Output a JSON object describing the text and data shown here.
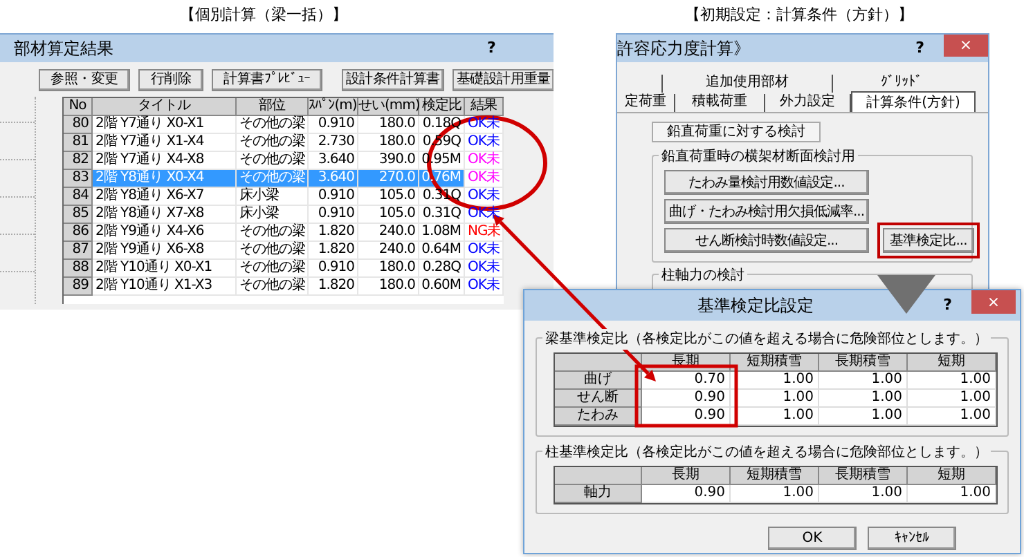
{
  "left_caption": "【個別計算（梁一括）】",
  "right_caption": "【初期設定：計算条件（方針）】",
  "result_window": {
    "title": "部材算定結果",
    "help": "?",
    "buttons": [
      "参照・変更",
      "行削除",
      "計算書ﾌﾟﾚﾋﾞｭｰ",
      "設計条件計算書",
      "基礎設計用重量"
    ],
    "table": {
      "columns": [
        "No",
        "タイトル",
        "部位",
        "ｽﾊﾟﾝ(m)",
        "せい(mm)",
        "検定比",
        "結果"
      ],
      "rows": [
        {
          "cells": [
            "80",
            "2階 Y7通り X0-X1",
            "その他の梁",
            "0.910",
            "180.0",
            "0.18Q",
            "OK未"
          ],
          "color": "#0000ff",
          "selected": false
        },
        {
          "cells": [
            "81",
            "2階 Y7通り X1-X4",
            "その他の梁",
            "2.730",
            "180.0",
            "0.59Q",
            "OK未"
          ],
          "color": "#0000ff",
          "selected": false
        },
        {
          "cells": [
            "82",
            "2階 Y7通り X4-X8",
            "その他の梁",
            "3.640",
            "390.0",
            "0.95M",
            "OK未"
          ],
          "color": "#ff00ff",
          "selected": false
        },
        {
          "cells": [
            "83",
            "2階 Y8通り X0-X4",
            "その他の梁",
            "3.640",
            "270.0",
            "0.76M",
            "OK未"
          ],
          "color": "#ff00ff",
          "selected": true
        },
        {
          "cells": [
            "84",
            "2階 Y8通り X6-X7",
            "床小梁",
            "0.910",
            "105.0",
            "0.31Q",
            "OK未"
          ],
          "color": "#0000ff",
          "selected": false
        },
        {
          "cells": [
            "85",
            "2階 Y8通り X7-X8",
            "床小梁",
            "0.910",
            "105.0",
            "0.31Q",
            "OK未"
          ],
          "color": "#0000ff",
          "selected": false
        },
        {
          "cells": [
            "86",
            "2階 Y9通り X4-X6",
            "その他の梁",
            "1.820",
            "240.0",
            "1.08M",
            "NG未"
          ],
          "color": "#ff0000",
          "selected": false
        },
        {
          "cells": [
            "87",
            "2階 Y9通り X6-X8",
            "その他の梁",
            "1.820",
            "240.0",
            "0.64M",
            "OK未"
          ],
          "color": "#0000ff",
          "selected": false
        },
        {
          "cells": [
            "88",
            "2階 Y10通り X0-X1",
            "その他の梁",
            "0.910",
            "180.0",
            "0.28Q",
            "OK未"
          ],
          "color": "#0000ff",
          "selected": false
        },
        {
          "cells": [
            "89",
            "2階 Y10通り X1-X3",
            "その他の梁",
            "1.820",
            "180.0",
            "0.60M",
            "OK未"
          ],
          "color": "#0000ff",
          "selected": false
        }
      ]
    }
  },
  "settings_window": {
    "title": "許容応力度計算》",
    "help": "?",
    "close": "×",
    "tabs_back": [
      {
        "label": "追加使用部材",
        "selected": false
      },
      {
        "label": "ｸﾞﾘｯﾄﾞ",
        "selected": false
      }
    ],
    "tabs_front": [
      {
        "label": "定荷重",
        "selected": false
      },
      {
        "label": "積載荷重",
        "selected": false
      },
      {
        "label": "外力設定",
        "selected": false
      },
      {
        "label": "計算条件(方針)",
        "selected": true
      }
    ],
    "sub_tab": "鉛直荷重に対する検討",
    "group_title": "鉛直荷重時の横架材断面検討用",
    "buttons": [
      {
        "label": "たわみ量検討用数値設定...",
        "highlighted": false
      },
      {
        "label": "曲げ・たわみ検討用欠損低減率...",
        "highlighted": false
      },
      {
        "label": "せん断検討時数値設定...",
        "highlighted": false
      },
      {
        "label": "基準検定比...",
        "highlighted": true
      }
    ],
    "group2_title": "柱軸力の検討"
  },
  "dialog": {
    "title": "基準検定比設定",
    "help": "?",
    "close": "×",
    "beam_group": {
      "title": "梁基準検定比（各検定比がこの値を超える場合に危険部位とします。）",
      "columns": [
        "長期",
        "短期積雪",
        "長期積雪",
        "短期"
      ],
      "rows": [
        {
          "label": "曲げ",
          "values": [
            "0.70",
            "1.00",
            "1.00",
            "1.00"
          ]
        },
        {
          "label": "せん断",
          "values": [
            "0.90",
            "1.00",
            "1.00",
            "1.00"
          ]
        },
        {
          "label": "たわみ",
          "values": [
            "0.90",
            "1.00",
            "1.00",
            "1.00"
          ]
        }
      ]
    },
    "column_group": {
      "title": "柱基準検定比（各検定比がこの値を超える場合に危険部位とします。）",
      "columns": [
        "長期",
        "短期積雪",
        "長期積雪",
        "短期"
      ],
      "rows": [
        {
          "label": "軸力",
          "values": [
            "0.90",
            "1.00",
            "1.00",
            "1.00"
          ]
        }
      ]
    },
    "buttons": [
      "OK",
      "ｷｬﾝｾﾙ"
    ]
  }
}
